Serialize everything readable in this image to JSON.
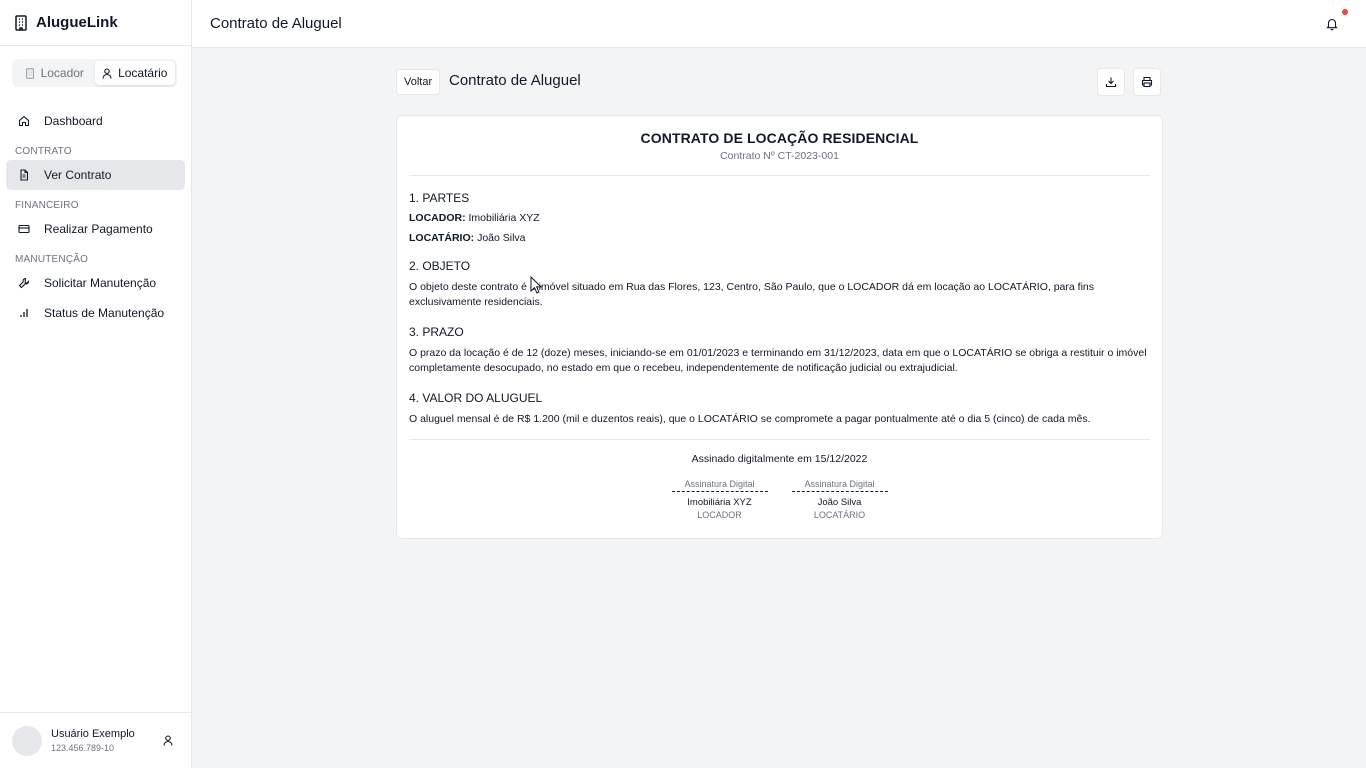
{
  "app": {
    "name": "AlugueLink"
  },
  "roles": {
    "landlord": "Locador",
    "tenant": "Locatário",
    "active": "tenant"
  },
  "nav": {
    "dashboard": "Dashboard",
    "section_contract": "CONTRATO",
    "view_contract": "Ver Contrato",
    "section_finance": "FINANCEIRO",
    "make_payment": "Realizar Pagamento",
    "section_maintenance": "MANUTENÇÃO",
    "request_maintenance": "Solicitar Manutenção",
    "maintenance_status": "Status de Manutenção"
  },
  "user": {
    "name": "Usuário Exemplo",
    "id": "123.456.789-10"
  },
  "topbar": {
    "title": "Contrato de Aluguel",
    "has_notification": true
  },
  "page": {
    "back_label": "Voltar",
    "title": "Contrato de Aluguel"
  },
  "contract": {
    "title": "CONTRATO DE LOCAÇÃO RESIDENCIAL",
    "number": "Contrato Nº CT-2023-001",
    "s1_title": "1. PARTES",
    "landlord_label": "LOCADOR:",
    "landlord_value": "Imobiliária XYZ",
    "tenant_label": "LOCATÁRIO:",
    "tenant_value": "João Silva",
    "s2_title": "2. OBJETO",
    "s2_text": "O objeto deste contrato é o imóvel situado em Rua das Flores, 123, Centro, São Paulo, que o LOCADOR dá em locação ao LOCATÁRIO, para fins exclusivamente residenciais.",
    "s3_title": "3. PRAZO",
    "s3_text": "O prazo da locação é de 12 (doze) meses, iniciando-se em 01/01/2023 e terminando em 31/12/2023, data em que o LOCATÁRIO se obriga a restituir o imóvel completamente desocupado, no estado em que o recebeu, independentemente de notificação judicial ou extrajudicial.",
    "s4_title": "4. VALOR DO ALUGUEL",
    "s4_text": "O aluguel mensal é de R$ 1.200 (mil e duzentos reais), que o LOCATÁRIO se compromete a pagar pontualmente até o dia 5 (cinco) de cada mês.",
    "signed_text": "Assinado digitalmente em 15/12/2022",
    "signatures": [
      {
        "label": "Assinatura Digital",
        "name": "Imobiliária XYZ",
        "role": "LOCADOR"
      },
      {
        "label": "Assinatura Digital",
        "name": "João Silva",
        "role": "LOCATÁRIO"
      }
    ]
  },
  "icons": {
    "brand": "building-icon",
    "landlord": "building-icon",
    "tenant": "user-icon",
    "dashboard": "home-icon",
    "contract": "file-text-icon",
    "payment": "credit-card-icon",
    "maintenance": "wrench-icon",
    "status": "bar-chart-icon",
    "bell": "bell-icon",
    "download": "download-icon",
    "print": "printer-icon"
  },
  "colors": {
    "notification_dot": "#ef4444",
    "active_nav": "#e5e7eb",
    "background": "#f3f4f6"
  }
}
